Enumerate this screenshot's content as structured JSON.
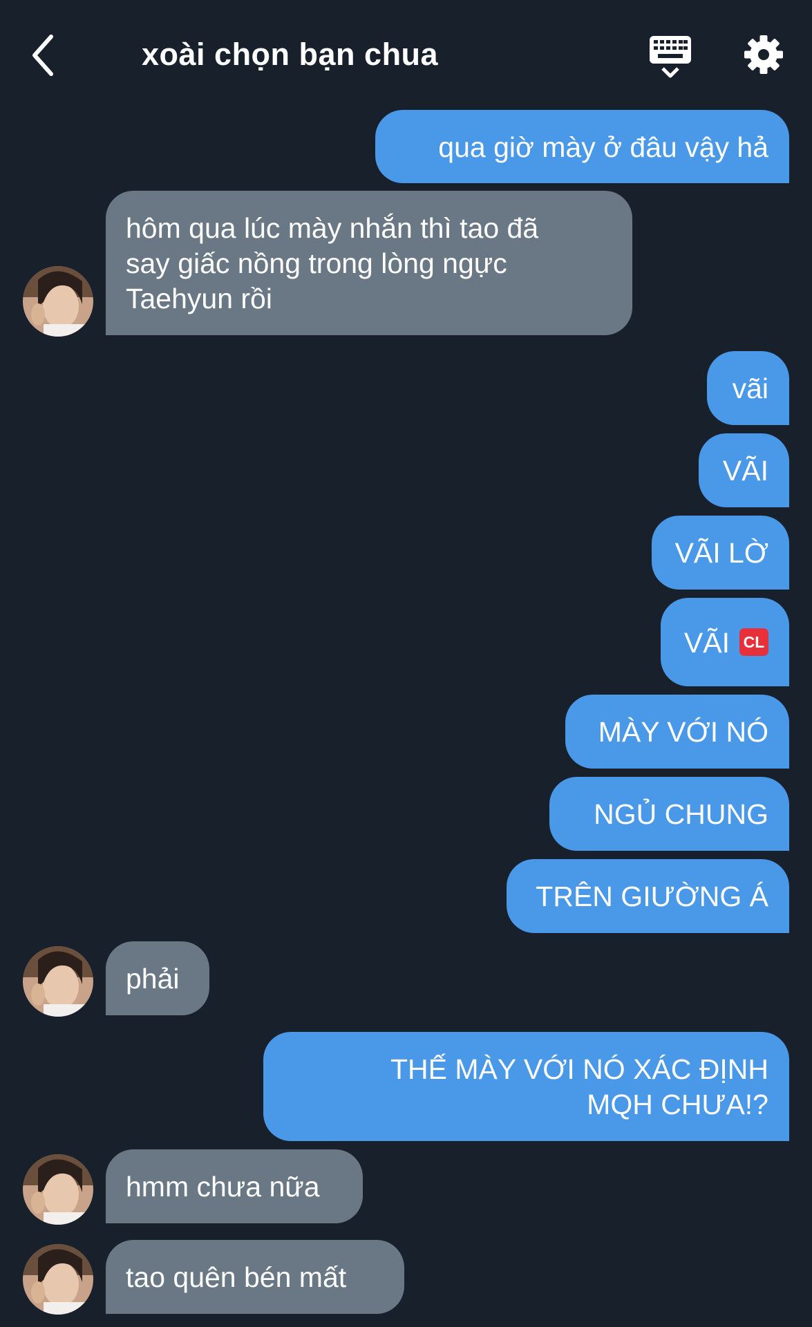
{
  "header": {
    "title": "xoài chọn bạn chua",
    "back_icon": "chevron-left-icon",
    "keyboard_icon": "keyboard-icon",
    "settings_icon": "gear-icon"
  },
  "colors": {
    "background": "#18202c",
    "outgoing_bubble": "#4a98e8",
    "incoming_bubble": "#6a7886",
    "text": "#ffffff"
  },
  "messages": [
    {
      "direction": "out",
      "text": "qua giờ mày ở đâu vậy hả"
    },
    {
      "direction": "in",
      "lines": [
        "hôm qua lúc mày nhắn thì tao đã",
        "say giấc nồng trong lòng ngực",
        "Taehyun rồi"
      ]
    },
    {
      "direction": "out",
      "text": "vãi"
    },
    {
      "direction": "out",
      "text": "VÃI"
    },
    {
      "direction": "out",
      "text": "VÃI LỜ"
    },
    {
      "direction": "out",
      "text": "VÃI",
      "emoji": "CL"
    },
    {
      "direction": "out",
      "text": "MÀY VỚI NÓ"
    },
    {
      "direction": "out",
      "text": "NGỦ CHUNG"
    },
    {
      "direction": "out",
      "text": "TRÊN GIƯỜNG Á"
    },
    {
      "direction": "in",
      "text": "phải"
    },
    {
      "direction": "out",
      "lines": [
        "THẾ MÀY VỚI NÓ XÁC ĐỊNH",
        "MQH CHƯA!?"
      ]
    },
    {
      "direction": "in",
      "text": "hmm chưa nữa"
    },
    {
      "direction": "in",
      "text": "tao quên bén mất"
    }
  ]
}
